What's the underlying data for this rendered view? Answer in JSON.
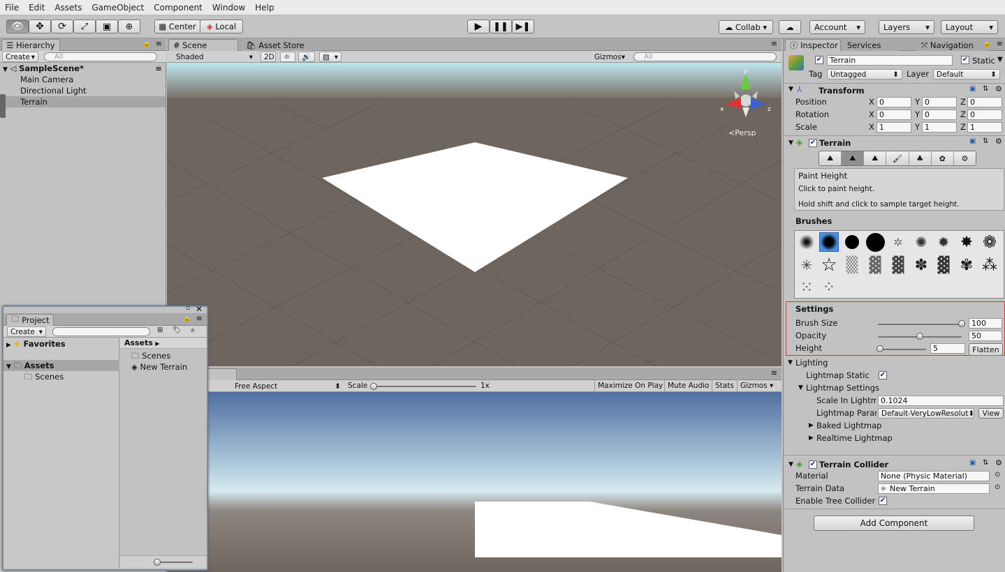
{
  "menu": [
    "File",
    "Edit",
    "Assets",
    "GameObject",
    "Component",
    "Window",
    "Help"
  ],
  "toolbar": {
    "pivot": "Center",
    "space": "Local",
    "collab": "Collab ▾",
    "account": "Account",
    "layers": "Layers",
    "layout": "Layout"
  },
  "hierarchy": {
    "tab": "Hierarchy",
    "create": "Create",
    "search_placeholder": "All",
    "scene": "SampleScene*",
    "items": [
      "Main Camera",
      "Directional Light",
      "Terrain"
    ]
  },
  "scene_view": {
    "tab_scene": "Scene",
    "tab_store": "Asset Store",
    "shading": "Shaded",
    "mode_2d": "2D",
    "gizmos": "Gizmos",
    "search_placeholder": "All",
    "persp": "Persp",
    "axis_x": "x",
    "axis_y": "y",
    "axis_z": "z"
  },
  "game_view": {
    "aspect": "Free Aspect",
    "scale_label": "Scale",
    "scale_value": "1x",
    "maximize": "Maximize On Play",
    "mute": "Mute Audio",
    "stats": "Stats",
    "gizmos": "Gizmos"
  },
  "project": {
    "tab": "Project",
    "create": "Create",
    "favorites": "Favorites",
    "assets": "Assets",
    "tree_scenes": "Scenes",
    "crumb": "Assets",
    "files": [
      "Scenes",
      "New Terrain"
    ]
  },
  "inspector": {
    "tabs": [
      "Inspector",
      "Services",
      "Navigation"
    ],
    "object_name": "Terrain",
    "static_label": "Static",
    "tag_label": "Tag",
    "tag_value": "Untagged",
    "layer_label": "Layer",
    "layer_value": "Default",
    "transform": {
      "title": "Transform",
      "rows": [
        {
          "label": "Position",
          "x": "0",
          "y": "0",
          "z": "0"
        },
        {
          "label": "Rotation",
          "x": "0",
          "y": "0",
          "z": "0"
        },
        {
          "label": "Scale",
          "x": "1",
          "y": "1",
          "z": "1"
        }
      ]
    },
    "terrain": {
      "title": "Terrain",
      "tool_title": "Paint Height",
      "tool_desc1": "Click to paint height.",
      "tool_desc2": "Hold shift and click to sample target height.",
      "brushes_label": "Brushes",
      "settings_label": "Settings",
      "brush_size_label": "Brush Size",
      "brush_size": "100",
      "brush_size_frac": 1.0,
      "opacity_label": "Opacity",
      "opacity": "50",
      "opacity_frac": 0.5,
      "height_label": "Height",
      "height": "5",
      "height_frac": 0.05,
      "flatten": "Flatten",
      "lighting": "Lighting",
      "lightmap_static": "Lightmap Static",
      "lightmap_settings": "Lightmap Settings",
      "scale_in_lightmap_label": "Scale In Lightm",
      "scale_in_lightmap": "0.1024",
      "lightmap_param_label": "Lightmap Parar",
      "lightmap_param": "Default-VeryLowResolut",
      "view": "View",
      "baked": "Baked Lightmap",
      "realtime": "Realtime Lightmap"
    },
    "collider": {
      "title": "Terrain Collider",
      "material_label": "Material",
      "material": "None (Physic Material)",
      "data_label": "Terrain Data",
      "data": "New Terrain",
      "tree_label": "Enable Tree Collider"
    },
    "add_component": "Add Component"
  },
  "colors": {
    "settings_highlight": "#d23a3a",
    "selection": "#a6a6a6"
  }
}
